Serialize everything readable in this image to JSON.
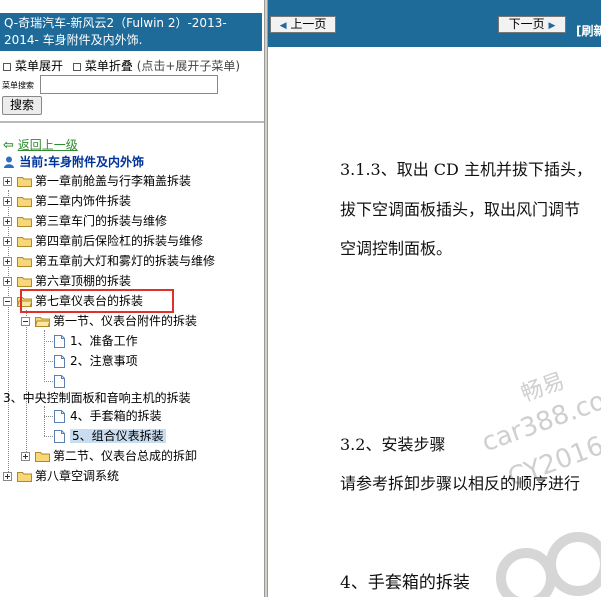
{
  "left_pane": {
    "title": "Q-奇瑞汽车-新风云2（Fulwin 2）-2013-2014- 车身附件及内外饰.",
    "menu_expand": "菜单展开",
    "menu_collapse": "菜单折叠",
    "menu_hint": "(点击+展开子菜单)",
    "search_label": "菜单搜索",
    "search_value": "",
    "search_button": "搜索",
    "back_link": "返回上一级",
    "current_label": "当前:车身附件及内外饰",
    "tree": {
      "ch1": "第一章前舱盖与行李箱盖拆装",
      "ch2": "第二章内饰件拆装",
      "ch3": "第三章车门的拆装与维修",
      "ch4": "第四章前后保险杠的拆装与维修",
      "ch5": "第五章前大灯和雾灯的拆装与维修",
      "ch6": "第六章顶棚的拆装",
      "ch7": "第七章仪表台的拆装",
      "sec1": "第一节、仪表台附件的拆装",
      "item1": "1、准备工作",
      "item2": "2、注意事项",
      "item3": "3、中央控制面板和音响主机的拆装",
      "item4": "4、手套箱的拆装",
      "item5": "5、组合仪表拆装",
      "sec2": "第二节、仪表台总成的拆卸",
      "ch8": "第八章空调系统"
    }
  },
  "right_pane": {
    "prev_button": "上一页",
    "next_button": "下一页",
    "print_link": "[刷新",
    "para1_line1": "3.1.3、取出 CD 主机并拔下插头，",
    "para1_line2": "拔下空调面板插头，取出风门调节",
    "para1_line3": "空调控制面板。",
    "section_heading": "3.2、安装步骤",
    "section_body": "请参考拆卸步骤以相反的顺序进行",
    "next_heading": "4、手套箱的拆装",
    "watermark_1": "畅易",
    "watermark_2": "car388.co",
    "watermark_3": "CY2016"
  },
  "colors": {
    "title_bar": "#1E6B9A",
    "selected_bg": "#c9ddf0",
    "highlight_border": "#e0302a",
    "back_link": "#2e8b2e",
    "current_text": "#003399"
  }
}
